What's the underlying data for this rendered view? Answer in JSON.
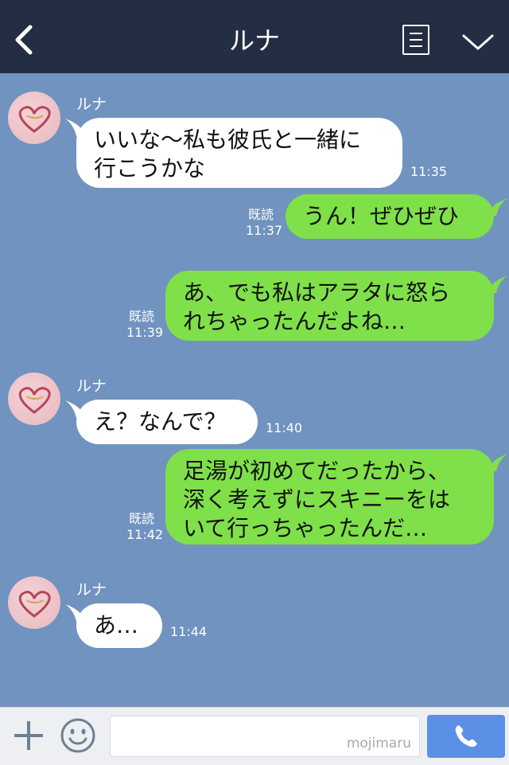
{
  "header": {
    "title": "ルナ"
  },
  "messages": [
    {
      "from": "ルナ",
      "text": "いいな〜私も彼氏と一緒に\n行こうかな",
      "time": "11:35"
    },
    {
      "from": "me",
      "text": "うん！ぜひぜひ",
      "read": "既読",
      "time": "11:37"
    },
    {
      "from": "me",
      "text": "あ、でも私はアラタに怒ら\nれちゃったんだよね…",
      "read": "既読",
      "time": "11:39"
    },
    {
      "from": "ルナ",
      "text": "え？なんで？",
      "time": "11:40"
    },
    {
      "from": "me",
      "text": "足湯が初めてだったから、\n深く考えずにスキニーをは\nいて行っちゃったんだ…",
      "read": "既読",
      "time": "11:42"
    },
    {
      "from": "ルナ",
      "text": "あ…",
      "time": "11:44"
    }
  ],
  "footer": {
    "watermark": "mojimaru"
  },
  "colors": {
    "header_bg": "#232d43",
    "chat_bg": "#7193c0",
    "incoming_bubble": "#ffffff",
    "outgoing_bubble": "#7fe04a",
    "call_button": "#5c8fe6"
  },
  "icons": [
    "back-arrow-icon",
    "menu-icon",
    "chevron-down-icon",
    "plus-icon",
    "emoji-icon",
    "phone-icon"
  ]
}
